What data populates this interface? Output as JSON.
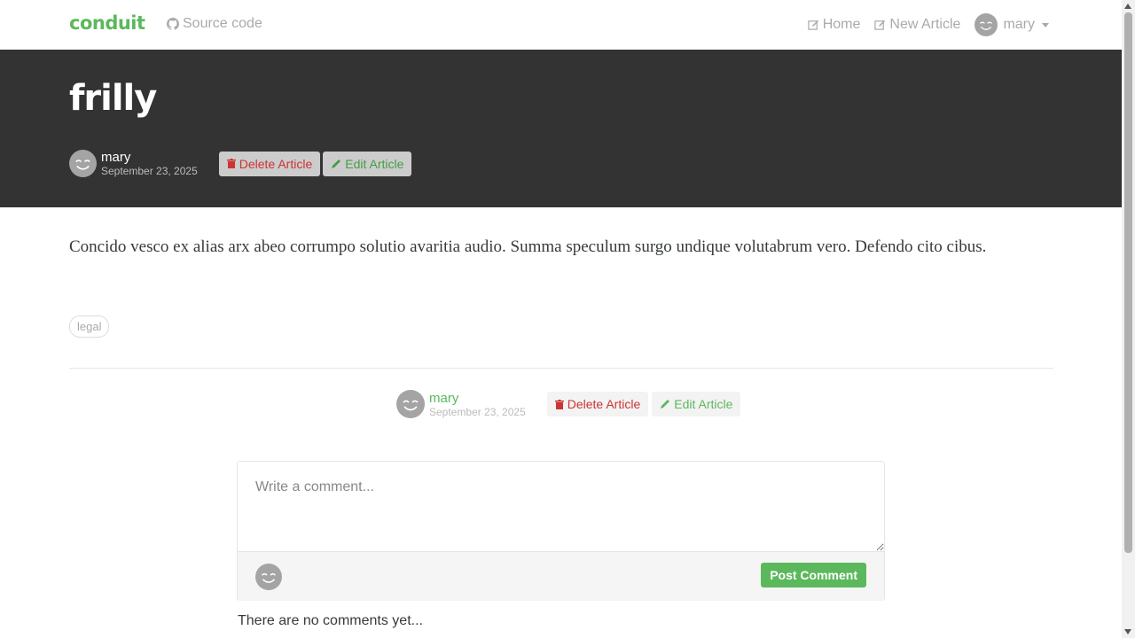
{
  "navbar": {
    "brand": "conduit",
    "source_label": "Source code",
    "home_label": "Home",
    "new_article_label": "New Article",
    "user_name": "mary"
  },
  "article": {
    "title": "frilly",
    "author": "mary",
    "date": "September 23, 2025",
    "delete_label": "Delete Article",
    "edit_label": "Edit Article",
    "body": "Concido vesco ex alias arx abeo corrumpo solutio avaritia audio. Summa speculum surgo undique volutabrum vero. Defendo cito cibus.",
    "tags": [
      "legal"
    ]
  },
  "comments": {
    "placeholder": "Write a comment...",
    "post_label": "Post Comment",
    "empty_text": "There are no comments yet..."
  },
  "colors": {
    "brand": "#5cb85c",
    "banner": "#333333",
    "danger": "#cc3333"
  }
}
